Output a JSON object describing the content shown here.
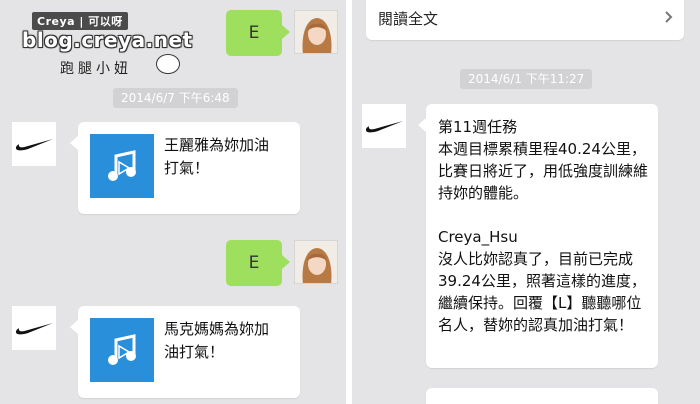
{
  "watermark": {
    "tag": "Creya | 可以呀",
    "url": "blog.creya.net",
    "subtitle": "跑腿小妞"
  },
  "left_pane": {
    "my_bubble_top": "E",
    "timestamp": "2014/6/7 下午6:48",
    "card1_title": "王麗雅為妳加油打氣！",
    "my_bubble_bottom": "E",
    "card2_title": "馬克媽媽為妳加油打氣！"
  },
  "right_pane": {
    "read_full_label": "閱讀全文",
    "timestamp": "2014/6/1 下午11:27",
    "message": "第11週任務\n本週目標累積里程40.24公里，比賽日將近了，用低強度訓練維持妳的體能。\n\nCreya_Hsu\n沒人比妳認真了，目前已完成39.24公里，照著這樣的進度，繼續保持。回覆【L】聽聽哪位名人，替妳的認真加油打氣！"
  },
  "icons": {
    "brand": "nike-swoosh-icon",
    "music": "music-note-icon",
    "chevron": "chevron-right-icon"
  },
  "colors": {
    "chat_bg": "#e4e4e6",
    "my_bubble": "#9edf5d",
    "music_tile": "#2a8fda",
    "timestamp_pill": "#d2d2d4"
  }
}
